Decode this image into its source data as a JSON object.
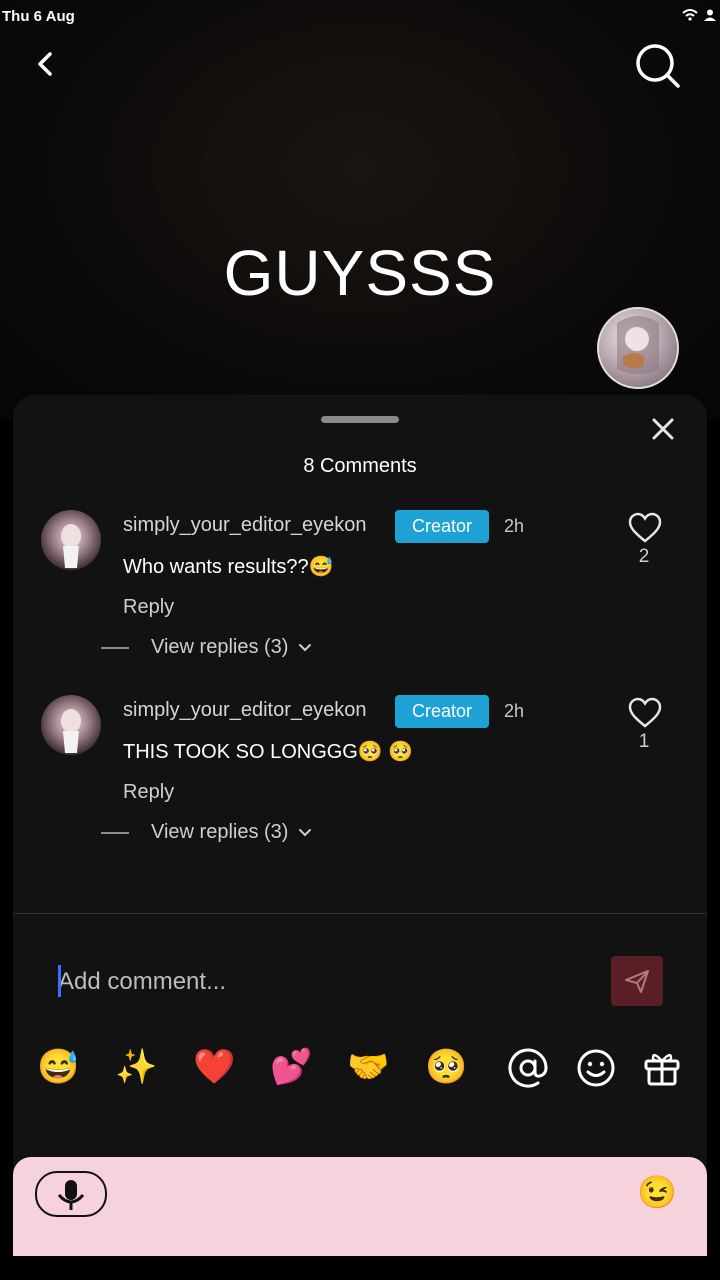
{
  "status_bar": {
    "date": "Thu 6 Aug"
  },
  "video": {
    "title": "GUYSSS"
  },
  "sheet": {
    "comments_count": "8 Comments"
  },
  "comments": [
    {
      "username": "simply_your_editor_eyekon",
      "badge": "Creator",
      "time": "2h",
      "text": "Who wants results??😅",
      "reply_label": "Reply",
      "likes": "2",
      "view_replies": "View replies (3)"
    },
    {
      "username": "simply_your_editor_eyekon",
      "badge": "Creator",
      "time": "2h",
      "text": "THIS TOOK SO LONGGG🥺 🥺",
      "reply_label": "Reply",
      "likes": "1",
      "view_replies": "View replies (3)"
    }
  ],
  "composer": {
    "placeholder": "Add comment..."
  },
  "quick_emojis": [
    "😅",
    "✨",
    "❤️",
    "💕",
    "🤝",
    "🥺"
  ],
  "quick_icons": [
    "at-icon",
    "smiley-icon",
    "gift-icon"
  ],
  "keyboard": {
    "emoji": "😉"
  },
  "colors": {
    "badge": "#1ea2d6",
    "send_button": "#5a1e26",
    "keyboard_bg": "#f6d3dc"
  }
}
